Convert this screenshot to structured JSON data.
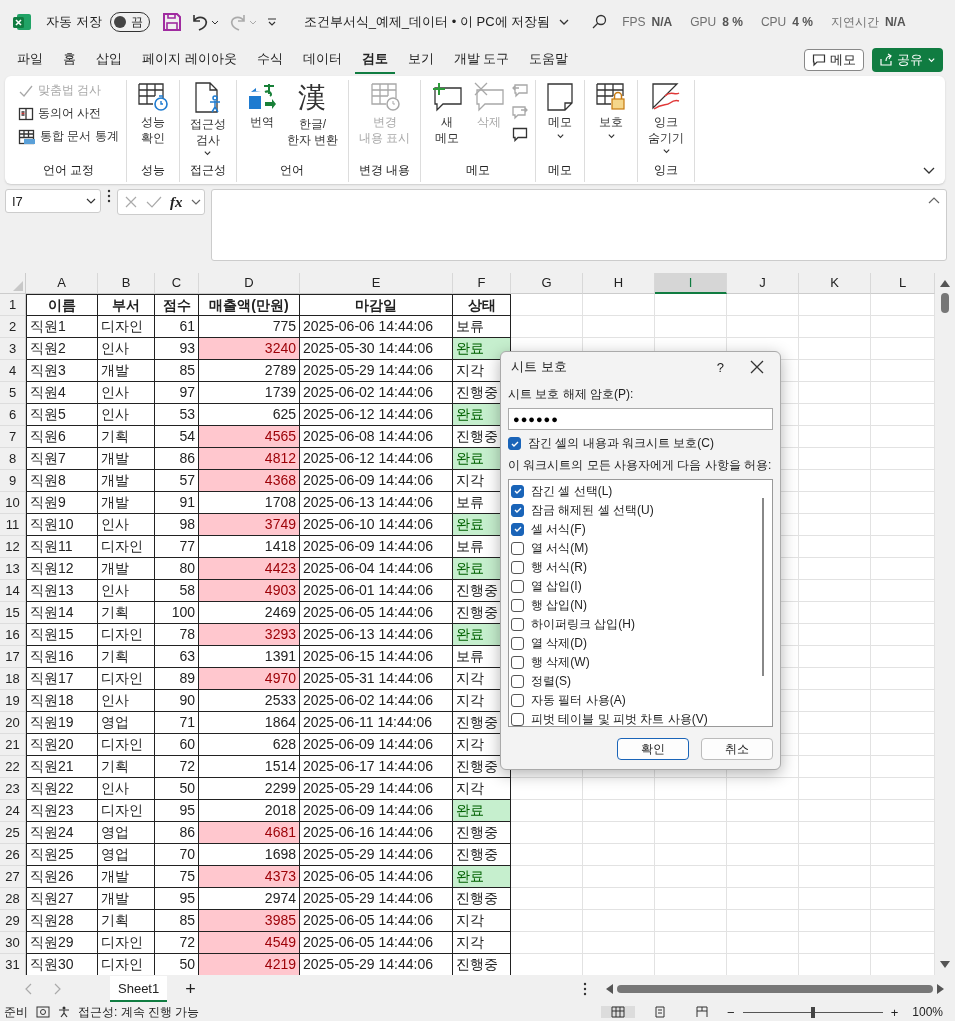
{
  "title_bar": {
    "autosave_label": "자동 저장",
    "autosave_on": false,
    "autosave_state": "끔",
    "document": "조건부서식_예제_데이터 • 이 PC에 저장됨",
    "overlay": [
      {
        "label": "FPS",
        "value": "N/A"
      },
      {
        "label": "GPU",
        "value": "8 %"
      },
      {
        "label": "CPU",
        "value": "4 %"
      },
      {
        "label": "지연시간",
        "value": "N/A"
      }
    ]
  },
  "menu_tabs": [
    {
      "label": "파일",
      "selected": false
    },
    {
      "label": "홈",
      "selected": false
    },
    {
      "label": "삽입",
      "selected": false
    },
    {
      "label": "페이지 레이아웃",
      "selected": false
    },
    {
      "label": "수식",
      "selected": false
    },
    {
      "label": "데이터",
      "selected": false
    },
    {
      "label": "검토",
      "selected": true
    },
    {
      "label": "보기",
      "selected": false
    },
    {
      "label": "개발 도구",
      "selected": false
    },
    {
      "label": "도움말",
      "selected": false
    }
  ],
  "header_buttons": {
    "comment": "메모",
    "share": "공유"
  },
  "ribbon": {
    "groups": [
      {
        "label": "언어 교정",
        "items": [
          {
            "kind": "small",
            "label": "맞춤법 검사",
            "disabled": true
          },
          {
            "kind": "small",
            "label": "동의어 사전",
            "disabled": false
          },
          {
            "kind": "small",
            "label": "통합 문서 통계",
            "disabled": false
          }
        ]
      },
      {
        "label": "성능",
        "items": [
          {
            "kind": "large",
            "label": "성능\n확인",
            "disabled": false,
            "dropdown": false
          }
        ]
      },
      {
        "label": "접근성",
        "items": [
          {
            "kind": "large",
            "label": "접근성\n검사",
            "disabled": false,
            "dropdown": true
          }
        ]
      },
      {
        "label": "언어",
        "items": [
          {
            "kind": "large",
            "label": "번역",
            "disabled": false,
            "dropdown": false
          },
          {
            "kind": "large",
            "label": "한글/\n한자 변환",
            "glyph": "漢",
            "disabled": false,
            "dropdown": false
          }
        ]
      },
      {
        "label": "변경 내용",
        "items": [
          {
            "kind": "large",
            "label": "변경\n내용 표시",
            "disabled": true,
            "dropdown": false
          }
        ]
      },
      {
        "label": "메모",
        "items": [
          {
            "kind": "large",
            "label": "새\n메모",
            "disabled": false,
            "dropdown": false
          },
          {
            "kind": "large",
            "label": "삭제",
            "disabled": true,
            "dropdown": false
          },
          {
            "kind": "icon",
            "disabled": true
          },
          {
            "kind": "icon",
            "disabled": true
          },
          {
            "kind": "icon",
            "disabled": false
          }
        ]
      },
      {
        "label": "메모",
        "items": [
          {
            "kind": "large",
            "label": "메모",
            "disabled": false,
            "dropdown": true
          }
        ]
      },
      {
        "items": [
          {
            "kind": "large",
            "label": "보호",
            "disabled": false,
            "dropdown": true
          }
        ]
      },
      {
        "label": "잉크",
        "items": [
          {
            "kind": "large",
            "label": "잉크\n숨기기",
            "disabled": false,
            "dropdown": true
          }
        ]
      }
    ]
  },
  "formula_bar": {
    "name_box": "I7",
    "fx": "fx"
  },
  "sheet": {
    "columns": [
      {
        "label": "A",
        "selected": false
      },
      {
        "label": "B",
        "selected": false
      },
      {
        "label": "C",
        "selected": false
      },
      {
        "label": "D",
        "selected": false
      },
      {
        "label": "E",
        "selected": false
      },
      {
        "label": "F",
        "selected": false
      },
      {
        "label": "G",
        "selected": false
      },
      {
        "label": "H",
        "selected": false
      },
      {
        "label": "I",
        "selected": true
      },
      {
        "label": "J",
        "selected": false
      },
      {
        "label": "K",
        "selected": false
      },
      {
        "label": "L",
        "selected": false
      }
    ],
    "header_row": {
      "num": "1",
      "cells": [
        "이름",
        "부서",
        "점수",
        "매출액(만원)",
        "마감일",
        "상태"
      ]
    },
    "rows": [
      {
        "num": "2",
        "name": "직원1",
        "dept": "디자인",
        "score": "61",
        "amount": "775",
        "amount_highlight": false,
        "deadline": "2025-06-06 14:44:06",
        "status": "보류",
        "status_highlight": false
      },
      {
        "num": "3",
        "name": "직원2",
        "dept": "인사",
        "score": "93",
        "amount": "3240",
        "amount_highlight": true,
        "deadline": "2025-05-30 14:44:06",
        "status": "완료",
        "status_highlight": true
      },
      {
        "num": "4",
        "name": "직원3",
        "dept": "개발",
        "score": "85",
        "amount": "2789",
        "amount_highlight": false,
        "deadline": "2025-05-29 14:44:06",
        "status": "지각",
        "status_highlight": false
      },
      {
        "num": "5",
        "name": "직원4",
        "dept": "인사",
        "score": "97",
        "amount": "1739",
        "amount_highlight": false,
        "deadline": "2025-06-02 14:44:06",
        "status": "진행중",
        "status_highlight": false
      },
      {
        "num": "6",
        "name": "직원5",
        "dept": "인사",
        "score": "53",
        "amount": "625",
        "amount_highlight": false,
        "deadline": "2025-06-12 14:44:06",
        "status": "완료",
        "status_highlight": true
      },
      {
        "num": "7",
        "name": "직원6",
        "dept": "기획",
        "score": "54",
        "amount": "4565",
        "amount_highlight": true,
        "deadline": "2025-06-08 14:44:06",
        "status": "진행중",
        "status_highlight": false
      },
      {
        "num": "8",
        "name": "직원7",
        "dept": "개발",
        "score": "86",
        "amount": "4812",
        "amount_highlight": true,
        "deadline": "2025-06-12 14:44:06",
        "status": "완료",
        "status_highlight": true
      },
      {
        "num": "9",
        "name": "직원8",
        "dept": "개발",
        "score": "57",
        "amount": "4368",
        "amount_highlight": true,
        "deadline": "2025-06-09 14:44:06",
        "status": "지각",
        "status_highlight": false
      },
      {
        "num": "10",
        "name": "직원9",
        "dept": "개발",
        "score": "91",
        "amount": "1708",
        "amount_highlight": false,
        "deadline": "2025-06-13 14:44:06",
        "status": "보류",
        "status_highlight": false
      },
      {
        "num": "11",
        "name": "직원10",
        "dept": "인사",
        "score": "98",
        "amount": "3749",
        "amount_highlight": true,
        "deadline": "2025-06-10 14:44:06",
        "status": "완료",
        "status_highlight": true
      },
      {
        "num": "12",
        "name": "직원11",
        "dept": "디자인",
        "score": "77",
        "amount": "1418",
        "amount_highlight": false,
        "deadline": "2025-06-09 14:44:06",
        "status": "보류",
        "status_highlight": false
      },
      {
        "num": "13",
        "name": "직원12",
        "dept": "개발",
        "score": "80",
        "amount": "4423",
        "amount_highlight": true,
        "deadline": "2025-06-04 14:44:06",
        "status": "완료",
        "status_highlight": true
      },
      {
        "num": "14",
        "name": "직원13",
        "dept": "인사",
        "score": "58",
        "amount": "4903",
        "amount_highlight": true,
        "deadline": "2025-06-01 14:44:06",
        "status": "진행중",
        "status_highlight": false
      },
      {
        "num": "15",
        "name": "직원14",
        "dept": "기획",
        "score": "100",
        "amount": "2469",
        "amount_highlight": false,
        "deadline": "2025-06-05 14:44:06",
        "status": "진행중",
        "status_highlight": false
      },
      {
        "num": "16",
        "name": "직원15",
        "dept": "디자인",
        "score": "78",
        "amount": "3293",
        "amount_highlight": true,
        "deadline": "2025-06-13 14:44:06",
        "status": "완료",
        "status_highlight": true
      },
      {
        "num": "17",
        "name": "직원16",
        "dept": "기획",
        "score": "63",
        "amount": "1391",
        "amount_highlight": false,
        "deadline": "2025-06-15 14:44:06",
        "status": "보류",
        "status_highlight": false
      },
      {
        "num": "18",
        "name": "직원17",
        "dept": "디자인",
        "score": "89",
        "amount": "4970",
        "amount_highlight": true,
        "deadline": "2025-05-31 14:44:06",
        "status": "지각",
        "status_highlight": false
      },
      {
        "num": "19",
        "name": "직원18",
        "dept": "인사",
        "score": "90",
        "amount": "2533",
        "amount_highlight": false,
        "deadline": "2025-06-02 14:44:06",
        "status": "지각",
        "status_highlight": false
      },
      {
        "num": "20",
        "name": "직원19",
        "dept": "영업",
        "score": "71",
        "amount": "1864",
        "amount_highlight": false,
        "deadline": "2025-06-11 14:44:06",
        "status": "진행중",
        "status_highlight": false
      },
      {
        "num": "21",
        "name": "직원20",
        "dept": "디자인",
        "score": "60",
        "amount": "628",
        "amount_highlight": false,
        "deadline": "2025-06-09 14:44:06",
        "status": "지각",
        "status_highlight": false
      },
      {
        "num": "22",
        "name": "직원21",
        "dept": "기획",
        "score": "72",
        "amount": "1514",
        "amount_highlight": false,
        "deadline": "2025-06-17 14:44:06",
        "status": "진행중",
        "status_highlight": false
      },
      {
        "num": "23",
        "name": "직원22",
        "dept": "인사",
        "score": "50",
        "amount": "2299",
        "amount_highlight": false,
        "deadline": "2025-05-29 14:44:06",
        "status": "지각",
        "status_highlight": false
      },
      {
        "num": "24",
        "name": "직원23",
        "dept": "디자인",
        "score": "95",
        "amount": "2018",
        "amount_highlight": false,
        "deadline": "2025-06-09 14:44:06",
        "status": "완료",
        "status_highlight": true
      },
      {
        "num": "25",
        "name": "직원24",
        "dept": "영업",
        "score": "86",
        "amount": "4681",
        "amount_highlight": true,
        "deadline": "2025-06-16 14:44:06",
        "status": "진행중",
        "status_highlight": false
      },
      {
        "num": "26",
        "name": "직원25",
        "dept": "영업",
        "score": "70",
        "amount": "1698",
        "amount_highlight": false,
        "deadline": "2025-05-29 14:44:06",
        "status": "진행중",
        "status_highlight": false
      },
      {
        "num": "27",
        "name": "직원26",
        "dept": "개발",
        "score": "75",
        "amount": "4373",
        "amount_highlight": true,
        "deadline": "2025-06-05 14:44:06",
        "status": "완료",
        "status_highlight": true
      },
      {
        "num": "28",
        "name": "직원27",
        "dept": "개발",
        "score": "95",
        "amount": "2974",
        "amount_highlight": false,
        "deadline": "2025-05-29 14:44:06",
        "status": "진행중",
        "status_highlight": false
      },
      {
        "num": "29",
        "name": "직원28",
        "dept": "기획",
        "score": "85",
        "amount": "3985",
        "amount_highlight": true,
        "deadline": "2025-06-05 14:44:06",
        "status": "지각",
        "status_highlight": false
      },
      {
        "num": "30",
        "name": "직원29",
        "dept": "디자인",
        "score": "72",
        "amount": "4549",
        "amount_highlight": true,
        "deadline": "2025-06-05 14:44:06",
        "status": "지각",
        "status_highlight": false
      },
      {
        "num": "31",
        "name": "직원30",
        "dept": "디자인",
        "score": "50",
        "amount": "4219",
        "amount_highlight": true,
        "deadline": "2025-05-29 14:44:06",
        "status": "진행중",
        "status_highlight": false
      }
    ]
  },
  "sheet_tabs": [
    {
      "label": "Sheet1",
      "selected": true
    }
  ],
  "add_sheet": "+",
  "status_bar": {
    "ready": "준비",
    "accessibility": "접근성: 계속 진행 가능",
    "zoom_minus": "−",
    "zoom_plus": "+",
    "zoom_slider": {
      "level": 0.5
    },
    "zoom": "100%"
  },
  "dialog": {
    "title": "시트 보호",
    "help": "?",
    "password_label": "시트 보호 해제 암호(P):",
    "password": "●●●●●●",
    "protect": {
      "label": "잠긴 셀의 내용과 워크시트 보호(C)",
      "checked": true
    },
    "allow_label": "이 워크시트의 모든 사용자에게 다음 사항을 허용:",
    "options": [
      {
        "label": "잠긴 셀 선택(L)",
        "checked": true
      },
      {
        "label": "잠금 해제된 셀 선택(U)",
        "checked": true
      },
      {
        "label": "셀 서식(F)",
        "checked": true
      },
      {
        "label": "열 서식(M)",
        "checked": false
      },
      {
        "label": "행 서식(R)",
        "checked": false
      },
      {
        "label": "열 삽입(I)",
        "checked": false
      },
      {
        "label": "행 삽입(N)",
        "checked": false
      },
      {
        "label": "하이퍼링크 삽입(H)",
        "checked": false
      },
      {
        "label": "열 삭제(D)",
        "checked": false
      },
      {
        "label": "행 삭제(W)",
        "checked": false
      },
      {
        "label": "정렬(S)",
        "checked": false
      },
      {
        "label": "자동 필터 사용(A)",
        "checked": false
      },
      {
        "label": "피벗 테이블 및 피벗 차트 사용(V)",
        "checked": false
      }
    ],
    "ok": "확인",
    "cancel": "취소"
  }
}
